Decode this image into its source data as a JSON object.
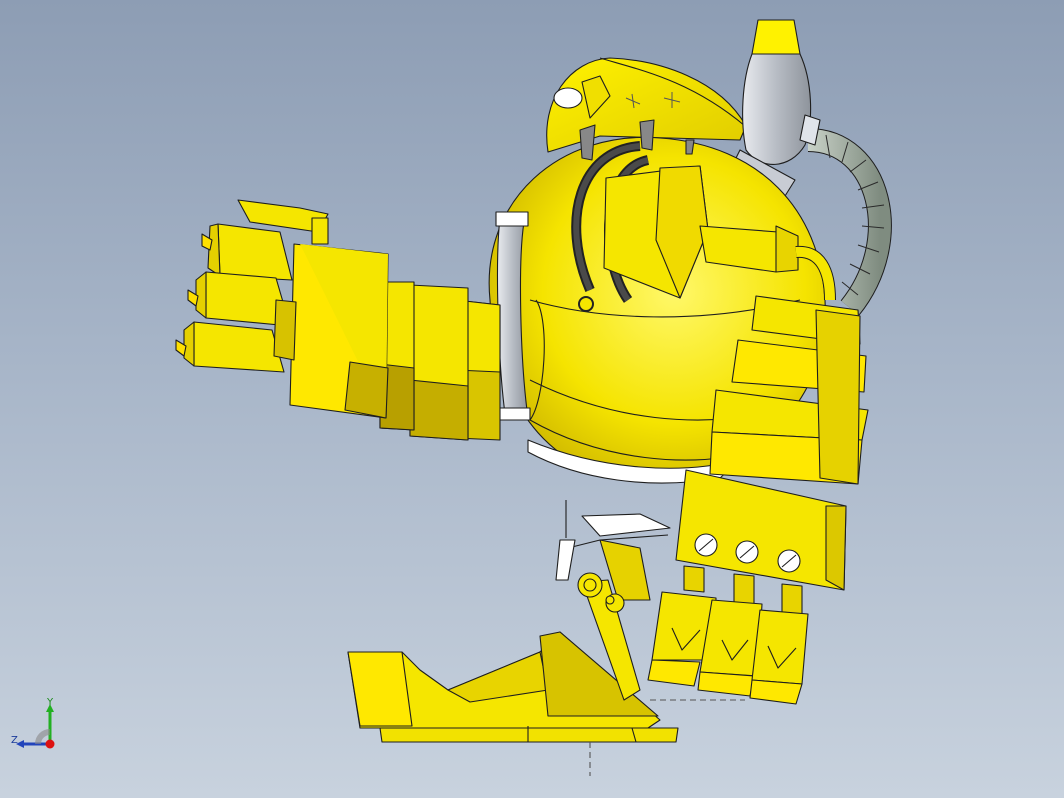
{
  "viewport": {
    "background_top": "#8d9db4",
    "background_bottom": "#c8d2de"
  },
  "model": {
    "part_color": "#f5e600",
    "part_shadow_color": "#c9b000",
    "metal_color": "#c8ccd4",
    "edge_color": "#1e1e1e"
  },
  "triad": {
    "y_label": "Y",
    "z_label": "Z",
    "y_color": "#22b022",
    "z_color": "#2244bb",
    "x_color": "#dd1111"
  }
}
